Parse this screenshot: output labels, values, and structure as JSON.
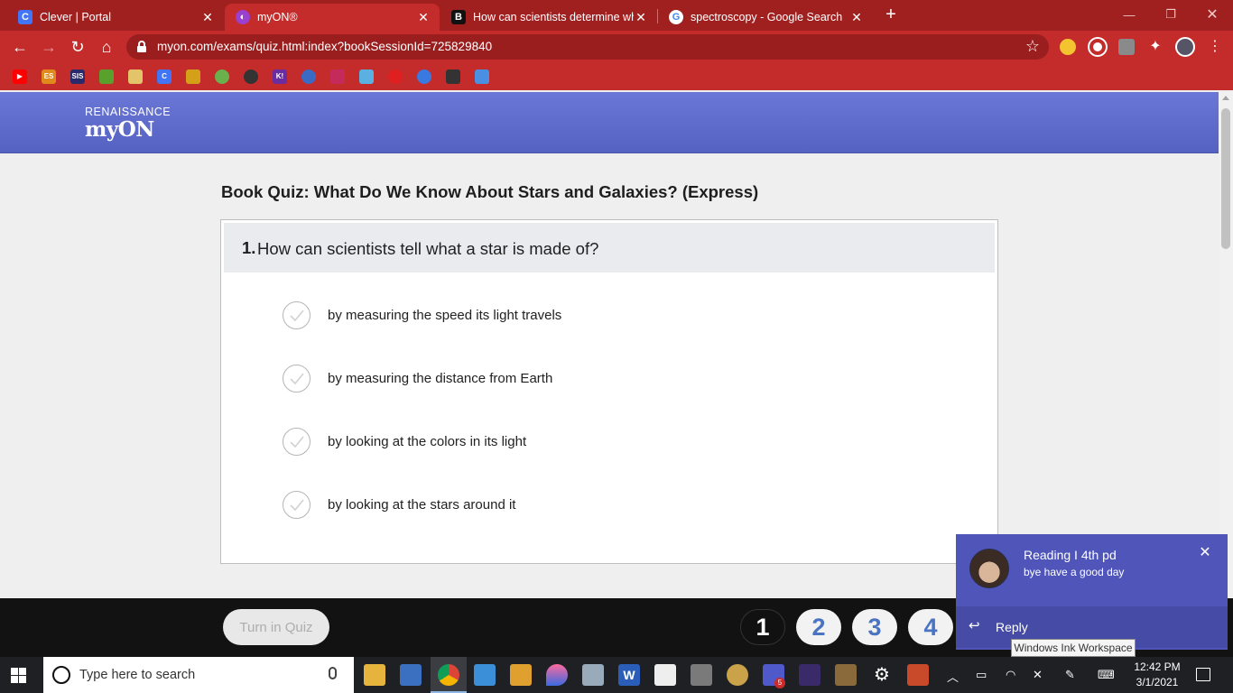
{
  "browser": {
    "tabs": [
      {
        "title": "Clever | Portal",
        "icon": "clever-icon",
        "color": "#4274f6",
        "glyph": "C"
      },
      {
        "title": "myON®",
        "icon": "myon-icon",
        "color": "#9b3fd0",
        "glyph": "◐"
      },
      {
        "title": "How can scientists determine wh",
        "icon": "brainly-icon",
        "color": "#111111",
        "glyph": "B"
      },
      {
        "title": "spectroscopy - Google Search",
        "icon": "google-icon",
        "color": "#ffffff",
        "glyph": "G"
      }
    ],
    "url": "myon.com/exams/quiz.html:index?bookSessionId=725829840"
  },
  "header": {
    "brand_top": "RENAISSANCE",
    "brand_main": "myON"
  },
  "quiz": {
    "title": "Book Quiz: What Do We Know About Stars and Galaxies? (Express)",
    "question_number": "1.",
    "question_text": "How can scientists tell what a star is made of?",
    "options": [
      "by measuring the speed its light travels",
      "by measuring the distance from Earth",
      "by looking at the colors in its light",
      "by looking at the stars around it"
    ]
  },
  "bottom": {
    "turn_in": "Turn in Quiz",
    "question_buttons": [
      "1",
      "2",
      "3",
      "4"
    ],
    "current_question": "1"
  },
  "notification": {
    "title": "Reading I 4th pd",
    "message": "bye have a good day",
    "reply": "Reply",
    "tooltip": "Windows Ink Workspace"
  },
  "taskbar": {
    "search_placeholder": "Type here to search",
    "time": "12:42 PM",
    "date": "3/1/2021",
    "teams_badge": "5"
  }
}
